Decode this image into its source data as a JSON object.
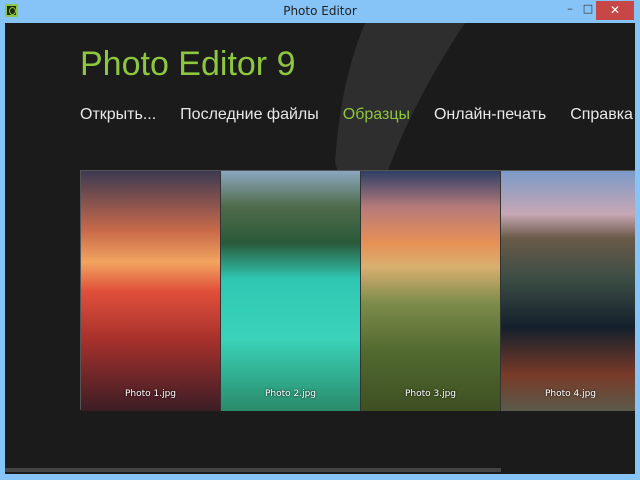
{
  "window": {
    "title": "Photo Editor",
    "minimize": "–",
    "maximize": "□",
    "close": "✕"
  },
  "app": {
    "title": "Photo Editor 9",
    "accent": "#8dc63f"
  },
  "nav": [
    {
      "label": "Открыть..."
    },
    {
      "label": "Последние файлы"
    },
    {
      "label": "Образцы",
      "active": true
    },
    {
      "label": "Онлайн-печать"
    },
    {
      "label": "Справка"
    }
  ],
  "photos": [
    {
      "caption": "Photo 1.jpg"
    },
    {
      "caption": "Photo 2.jpg"
    },
    {
      "caption": "Photo 3.jpg"
    },
    {
      "caption": "Photo 4.jpg"
    }
  ]
}
